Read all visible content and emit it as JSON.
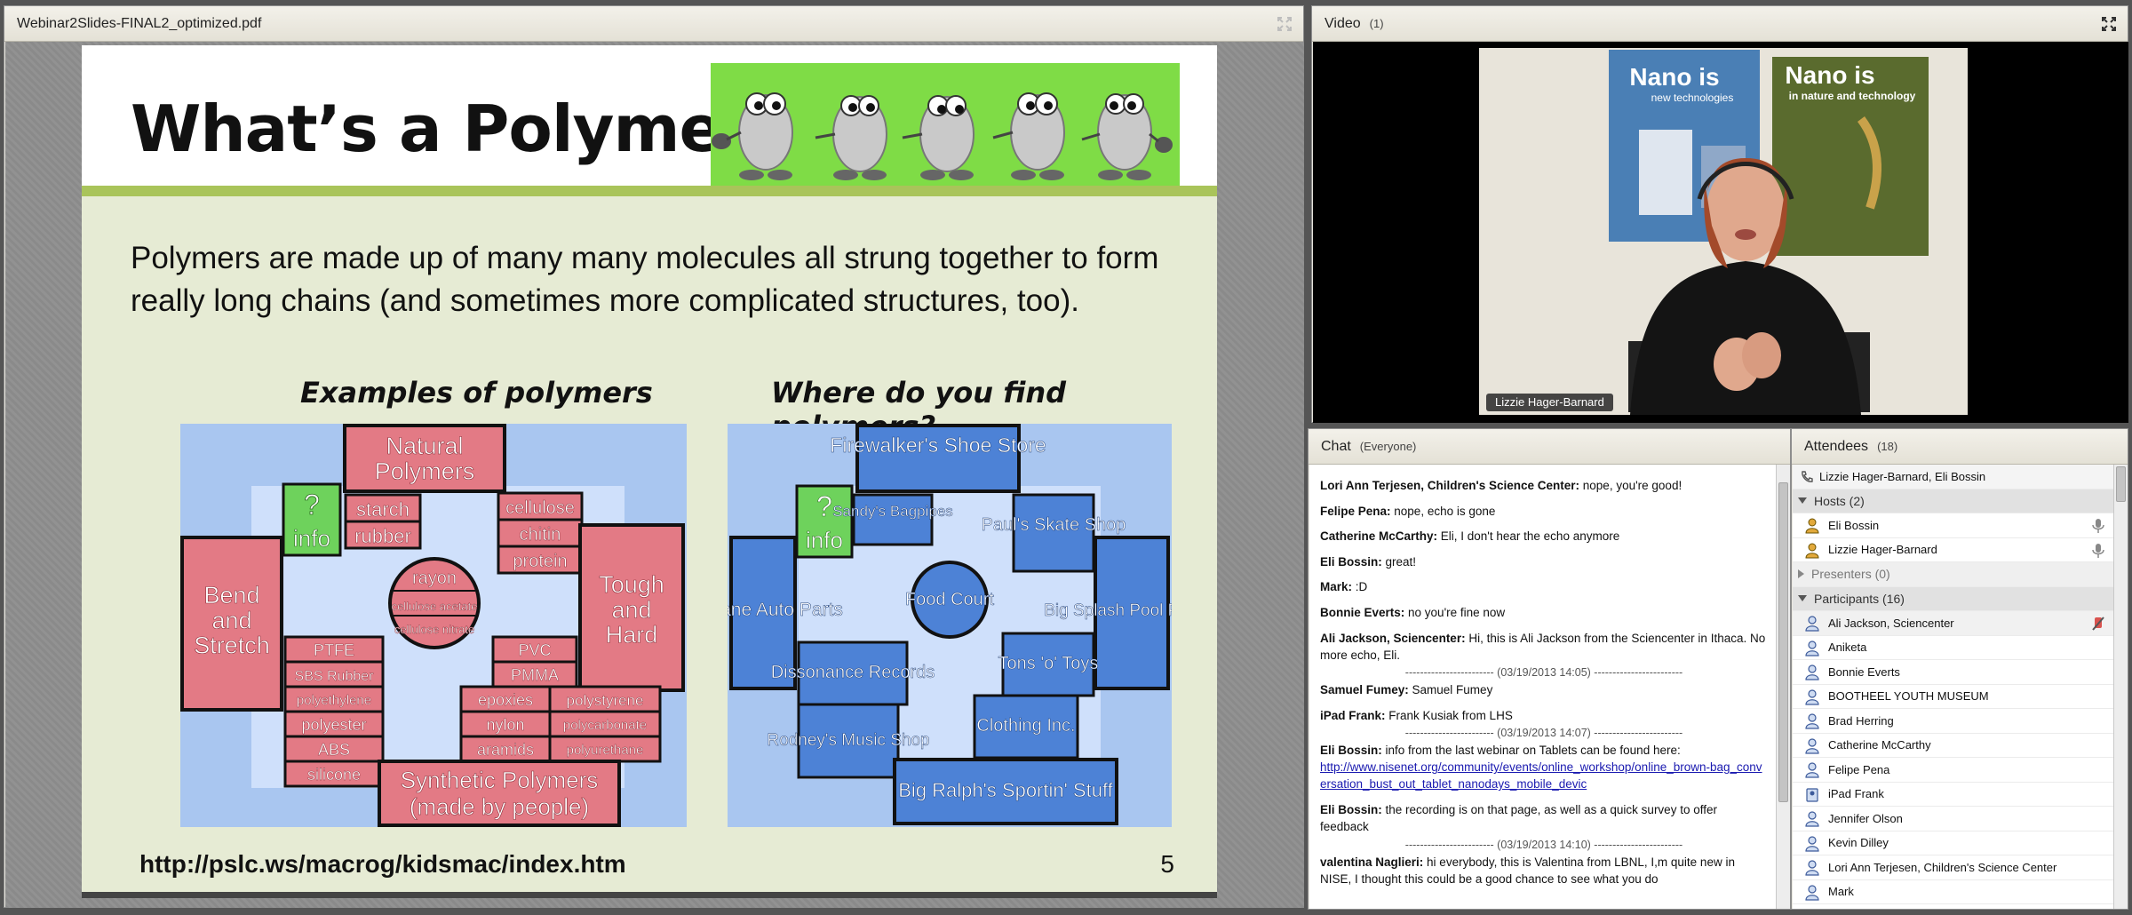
{
  "share_pod": {
    "title": "Webinar2Slides-FINAL2_optimized.pdf",
    "slide": {
      "title": "What’s a Polymer?",
      "body": "Polymers are made up of many many molecules all strung together to form really long chains (and sometimes more complicated structures, too).",
      "left_heading": "Examples of polymers",
      "right_heading": "Where do you find polymers?",
      "url": "http://pslc.ws/macrog/kidsmac/index.htm",
      "page_number": "5",
      "left_diagram": {
        "natural_polymers": "Natural Polymers",
        "info": "info",
        "q": "?",
        "starch": "starch",
        "rubber": "rubber",
        "cellulose": "cellulose",
        "chitin": "chitin",
        "protein": "protein",
        "bend": "Bend and Stretch",
        "tough": "Tough and Hard",
        "rayon": "rayon",
        "cellulose_acetate": "cellulose acetate",
        "cellulose_nitrate": "cellulose nitrate",
        "ptfe": "PTFE",
        "sbs": "SBS Rubber",
        "polyethylene": "polyethylene",
        "polyester": "polyester",
        "abs": "ABS",
        "silicone": "silicone",
        "pvc": "PVC",
        "pmma": "PMMA",
        "epoxies": "epoxies",
        "polystyrene": "polystyrene",
        "nylon": "nylon",
        "polycarbonate": "polycarbonate",
        "aramids": "aramids",
        "polyurethane": "polyurethane",
        "synthetic": "Synthetic Polymers",
        "made_by_people": "(made by people)"
      },
      "right_diagram": {
        "firewalker": "Firewalker's Shoe Store",
        "info": "info",
        "q": "?",
        "sandys": "Sandy's Bagpipes",
        "pauls": "Paul's Skate Shop",
        "pit_lane": "Pit Lane Auto Parts",
        "food_court": "Food Court",
        "big_splash": "Big Splash Pool Palace",
        "dissonance": "Dissonance Records",
        "tons": "Tons 'o' Toys",
        "rodneys": "Rodney's Music Shop",
        "clothing": "Clothing Inc.",
        "big_ralphs": "Big Ralph's Sportin' Stuff"
      }
    }
  },
  "video_pod": {
    "title": "Video",
    "count": "(1)",
    "presenter_label": "Lizzie Hager-Barnard",
    "poster_left_title": "Nano is",
    "poster_left_sub": "new technologies",
    "poster_right_title": "Nano is",
    "poster_right_sub": "in nature and technology"
  },
  "chat_pod": {
    "title": "Chat",
    "scope": "(Everyone)",
    "messages": [
      {
        "author": "Lori Ann Terjesen, Children's Science Center:",
        "text": " nope, you're good!"
      },
      {
        "author": "Felipe Pena:",
        "text": " nope, echo is gone"
      },
      {
        "author": "Catherine McCarthy:",
        "text": " Eli, I don't hear the echo anymore"
      },
      {
        "author": "Eli Bossin:",
        "text": " great!"
      },
      {
        "author": "Mark:",
        "text": " :D"
      },
      {
        "author": "Bonnie Everts:",
        "text": " no you're fine now"
      },
      {
        "author": "Ali Jackson, Sciencenter:",
        "text": " Hi, this is Ali Jackson from the Sciencenter in Ithaca. No more echo, Eli."
      },
      {
        "separator": "------------------------ (03/19/2013 14:05) ------------------------"
      },
      {
        "author": "Samuel Fumey:",
        "text": " Samuel Fumey"
      },
      {
        "author": "iPad Frank:",
        "text": " Frank Kusiak from LHS"
      },
      {
        "separator": "------------------------ (03/19/2013 14:07) ------------------------"
      },
      {
        "author": "Eli Bossin:",
        "text": " info from the last webinar on Tablets can be found here:",
        "link": "http://www.nisenet.org/community/events/online_workshop/online_brown-bag_conversation_bust_out_tablet_nanodays_mobile_devic"
      },
      {
        "author": "Eli Bossin:",
        "text": " the recording is on that page, as well as a quick survey to offer feedback"
      },
      {
        "separator": "------------------------ (03/19/2013 14:10) ------------------------"
      },
      {
        "author": "valentina Naglieri:",
        "text": " hi everybody, this is Valentina from LBNL, I,m quite new in NISE, I thought this could be a good chance to see what you do"
      }
    ]
  },
  "attendees_pod": {
    "title": "Attendees",
    "count": "(18)",
    "speaking": "Lizzie Hager-Barnard, Eli Bossin",
    "hosts_label": "Hosts (2)",
    "hosts": [
      "Eli Bossin",
      "Lizzie Hager-Barnard"
    ],
    "presenters_label": "Presenters (0)",
    "participants_label": "Participants (16)",
    "participants": [
      "Ali Jackson, Sciencenter",
      "Aniketa",
      "Bonnie Everts",
      "BOOTHEEL YOUTH MUSEUM",
      "Brad Herring",
      "Catherine McCarthy",
      "Felipe Pena",
      "iPad Frank",
      "Jennifer Olson",
      "Kevin Dilley",
      "Lori Ann Terjesen, Children's Science Center",
      "Mark"
    ]
  },
  "colors": {
    "slide_bg": "#e6ebd4",
    "slide_green": "#a9c45a",
    "natural_box": "#e37a85",
    "shop_blue": "#4d82d6",
    "info_green": "#6ed25c",
    "link": "#1a1ab0"
  }
}
